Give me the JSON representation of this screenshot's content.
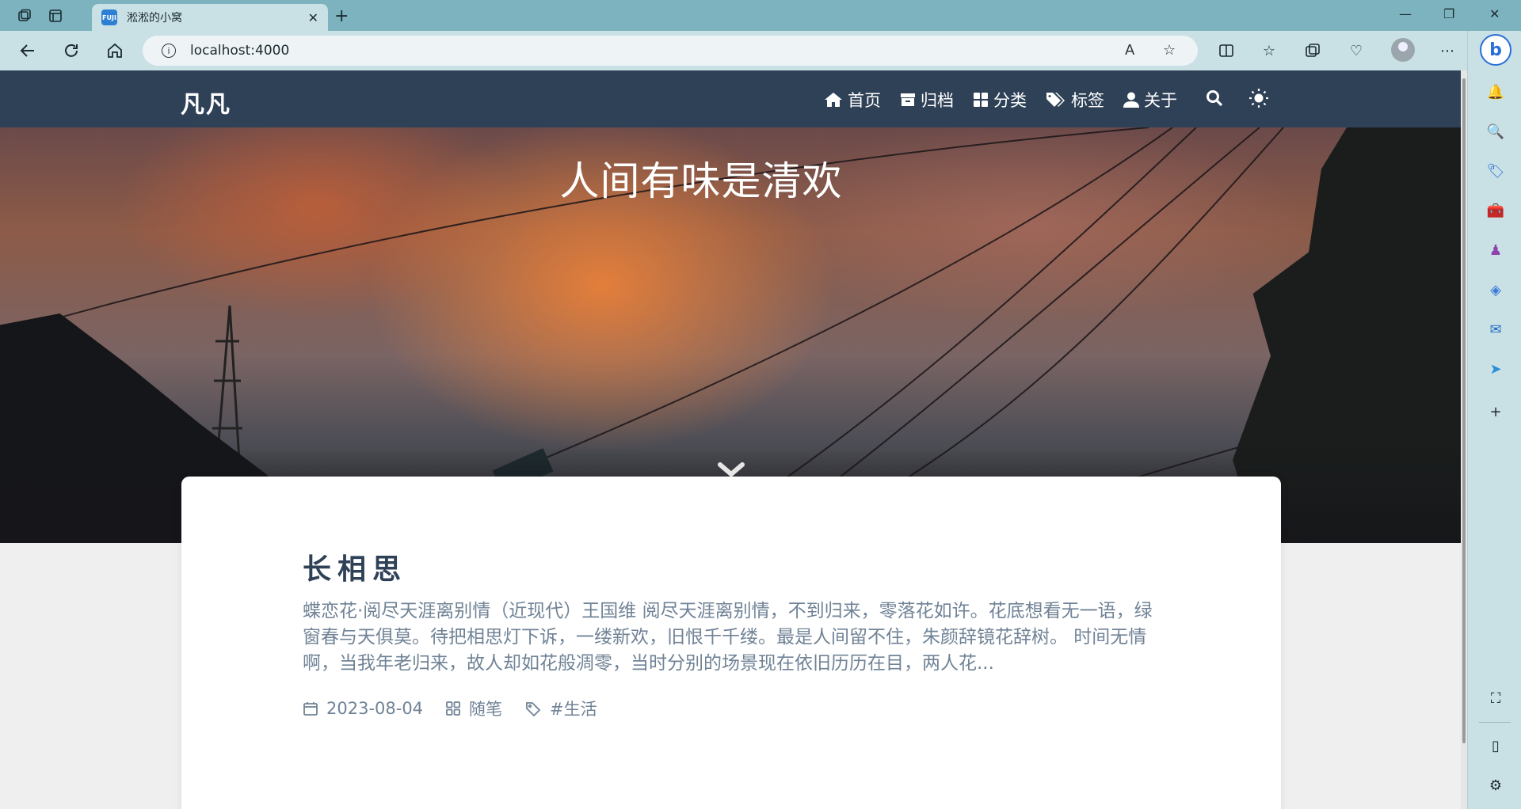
{
  "browser": {
    "tab_title": "淞淞的小窝",
    "favicon_text": "FUJI",
    "url": "localhost:4000"
  },
  "site": {
    "brand": "凡凡",
    "menu": [
      {
        "label": "首页",
        "icon": "home-icon"
      },
      {
        "label": "归档",
        "icon": "archive-icon"
      },
      {
        "label": "分类",
        "icon": "category-icon"
      },
      {
        "label": "标签",
        "icon": "tags-icon"
      },
      {
        "label": "关于",
        "icon": "user-icon"
      }
    ],
    "hero_title": "人间有味是清欢"
  },
  "post": {
    "title": "长相思",
    "excerpt": "蝶恋花·阅尽天涯离别情（近现代）王国维 阅尽天涯离别情，不到归来，零落花如许。花底想看无一语，绿窗春与天俱莫。待把相思灯下诉，一缕新欢，旧恨千千缕。最是人间留不住，朱颜辞镜花辞树。 时间无情啊，当我年老归来，故人却如花般凋零，当时分别的场景现在依旧历历在目，两人花...",
    "date": "2023-08-04",
    "category": "随笔",
    "tag": "#生活"
  },
  "colors": {
    "header_bg": "#2f4157",
    "text_muted": "#708396",
    "browser_frame": "#7cb3bf"
  }
}
